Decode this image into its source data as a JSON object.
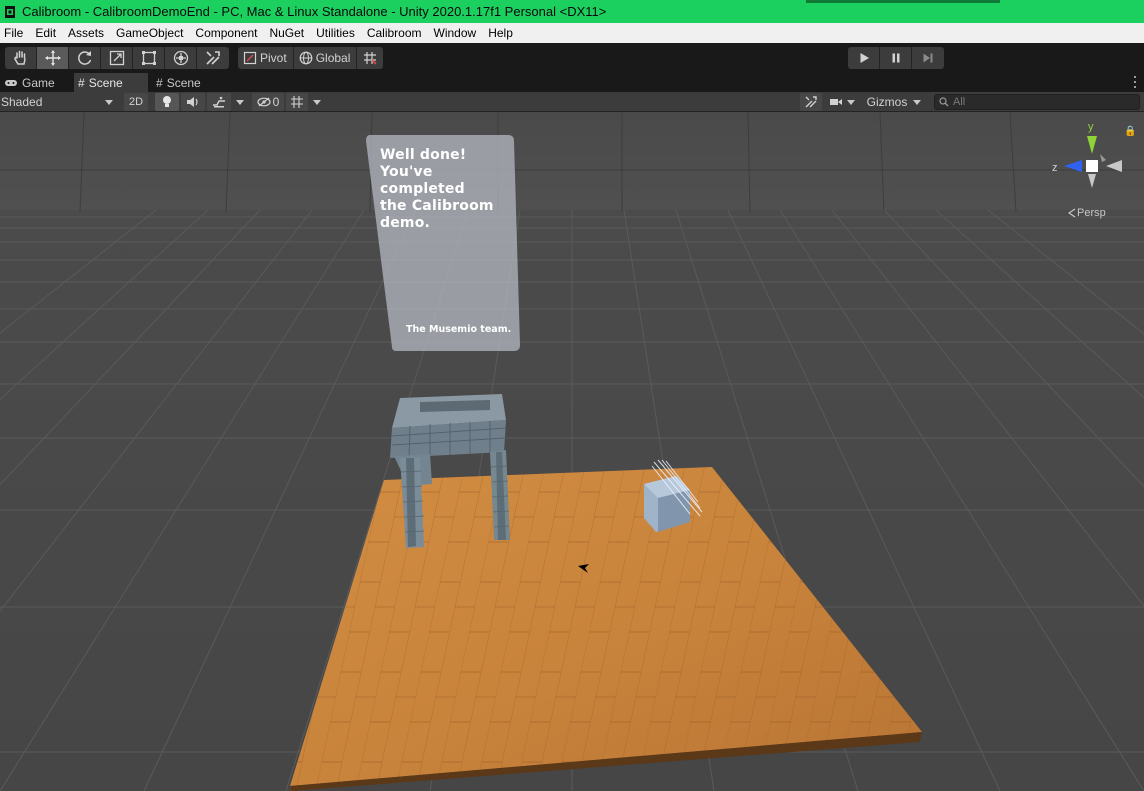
{
  "window": {
    "title": "Calibroom - CalibroomDemoEnd - PC, Mac & Linux Standalone - Unity 2020.1.17f1 Personal <DX11>",
    "app_icon": "unity-logo-icon",
    "titlebar_color": "#1cd05f"
  },
  "menubar": {
    "items": [
      {
        "label": "File"
      },
      {
        "label": "Edit"
      },
      {
        "label": "Assets"
      },
      {
        "label": "GameObject"
      },
      {
        "label": "Component"
      },
      {
        "label": "NuGet"
      },
      {
        "label": "Utilities"
      },
      {
        "label": "Calibroom"
      },
      {
        "label": "Window"
      },
      {
        "label": "Help"
      }
    ]
  },
  "toolbar": {
    "tools": [
      {
        "name": "hand-tool",
        "icon": "hand-icon",
        "active": false
      },
      {
        "name": "move-tool",
        "icon": "move-arrows-icon",
        "active": true
      },
      {
        "name": "rotate-tool",
        "icon": "rotate-icon",
        "active": false
      },
      {
        "name": "scale-tool",
        "icon": "scale-icon",
        "active": false
      },
      {
        "name": "rect-tool",
        "icon": "rect-icon",
        "active": false
      },
      {
        "name": "transform-tool",
        "icon": "transform-icon",
        "active": false
      },
      {
        "name": "custom-tool",
        "icon": "tools-icon",
        "active": false
      }
    ],
    "pivot_label": "Pivot",
    "global_label": "Global",
    "snap_icon": "grid-snap-icon",
    "play_icon": "play-icon",
    "pause_icon": "pause-icon",
    "step_icon": "step-icon"
  },
  "tabs": [
    {
      "label": "Game",
      "icon": "gamepad-icon",
      "active": false
    },
    {
      "label": "Scene",
      "icon": "hash-icon",
      "active": true
    },
    {
      "label": "Scene",
      "icon": "hash-icon",
      "active": false
    }
  ],
  "scenebar": {
    "draw_mode": "Shaded",
    "mode_2d": "2D",
    "hidden_count": "0",
    "gizmos_label": "Gizmos",
    "search_placeholder": "All"
  },
  "viewport": {
    "panel_text": "Well done!\n You've completed\n the Calibroom\n demo.",
    "panel_sign": "The Musemio team.",
    "persp_label": "Persp",
    "axis_y": "y",
    "axis_z": "z",
    "axis_colors": {
      "y": "#8fd33b",
      "z": "#2f62f0",
      "x": "#d8d8d8"
    }
  }
}
